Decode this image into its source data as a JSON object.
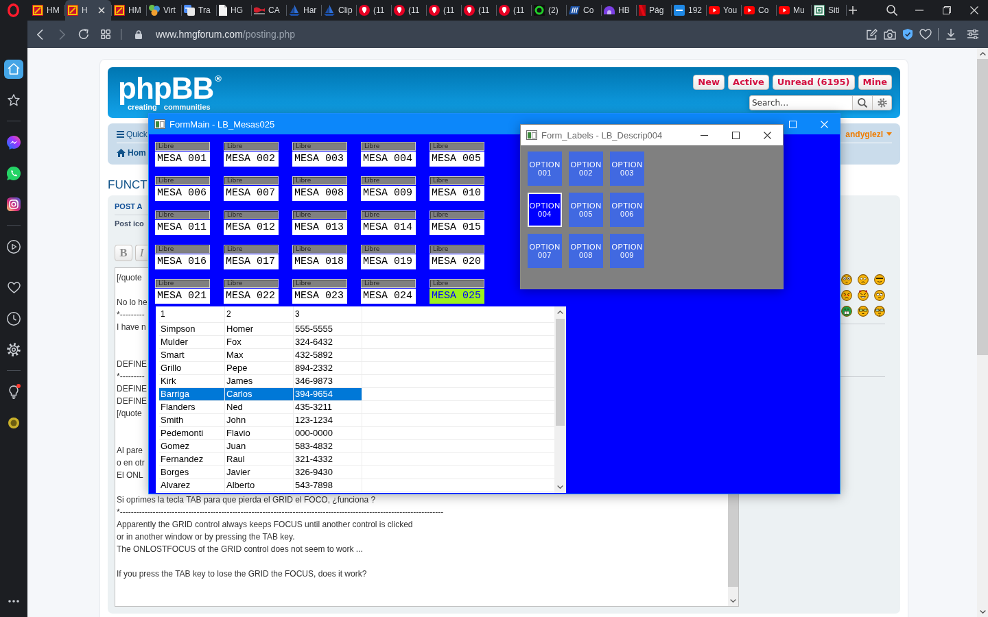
{
  "browser": {
    "tabs": [
      {
        "title": "HM",
        "kind": "hmg",
        "selected": false
      },
      {
        "title": "H",
        "kind": "hmg",
        "selected": true
      },
      {
        "title": "HM",
        "kind": "hmg",
        "selected": false
      },
      {
        "title": "Virt",
        "kind": "gears",
        "selected": false
      },
      {
        "title": "Tra",
        "kind": "translate",
        "selected": false
      },
      {
        "title": "HG",
        "kind": "document",
        "selected": false
      },
      {
        "title": "CA",
        "kind": "flag",
        "selected": false
      },
      {
        "title": "Har",
        "kind": "sail",
        "selected": false
      },
      {
        "title": "Clip",
        "kind": "sail",
        "selected": false
      },
      {
        "title": "(11",
        "kind": "pin",
        "selected": false
      },
      {
        "title": "(11",
        "kind": "pin",
        "selected": false
      },
      {
        "title": "(11",
        "kind": "pin",
        "selected": false
      },
      {
        "title": "(11",
        "kind": "pin",
        "selected": false
      },
      {
        "title": "(11",
        "kind": "pin",
        "selected": false
      },
      {
        "title": "(2)",
        "kind": "arc",
        "selected": false
      },
      {
        "title": "Co",
        "kind": "stripes",
        "selected": false
      },
      {
        "title": "HB",
        "kind": "arches",
        "selected": false
      },
      {
        "title": "Pág",
        "kind": "ribbon",
        "selected": false
      },
      {
        "title": "192",
        "kind": "tile",
        "selected": false
      },
      {
        "title": "You",
        "kind": "play",
        "selected": false
      },
      {
        "title": "Co",
        "kind": "play",
        "selected": false
      },
      {
        "title": "Mu",
        "kind": "play",
        "selected": false
      },
      {
        "title": "Siti",
        "kind": "seal",
        "selected": false
      }
    ],
    "address": {
      "url": "**www.hmgforum.com**/posting.php"
    },
    "sidebar": {
      "groups": [
        [
          {
            "kind": "home",
            "selected": true,
            "badge": false
          },
          {
            "kind": "star",
            "selected": false,
            "badge": false
          }
        ],
        [
          {
            "kind": "chat",
            "selected": false,
            "badge": false
          },
          {
            "kind": "phone",
            "selected": false,
            "badge": false
          },
          {
            "kind": "camera",
            "selected": false,
            "badge": false
          }
        ],
        [
          {
            "kind": "player",
            "selected": false,
            "badge": false
          },
          {
            "kind": "heart",
            "selected": false,
            "badge": false
          },
          {
            "kind": "history",
            "selected": false,
            "badge": false
          },
          {
            "kind": "settings",
            "selected": false,
            "badge": false
          }
        ],
        [
          {
            "kind": "bulb",
            "selected": false,
            "badge": true
          },
          {
            "kind": "extension",
            "selected": false,
            "badge": false
          }
        ]
      ]
    }
  },
  "forum": {
    "logo": {
      "name": "phpBB$^{®}$",
      "tagline": [
        "creating",
        "communities"
      ]
    },
    "quick_links": [
      "New",
      "Active",
      "Unread (6195)",
      "Mine"
    ],
    "search": {
      "placeholder": "Search…"
    },
    "navbar": {
      "quick_links": "Quick",
      "home": "Hom",
      "user": "andyglezl"
    },
    "title": "FUNCT",
    "post": {
      "heading": "POST A",
      "post_icon_label": "Post ico",
      "format_buttons": [
        {
          "label": "B",
          "kind": "bold"
        },
        {
          "label": "I",
          "kind": "italic"
        }
      ],
      "message": [
        {
          "kind": "text",
          "text": "[/quote"
        },
        {
          "kind": "blank"
        },
        {
          "kind": "text",
          "text": "No lo he"
        },
        {
          "kind": "text",
          "text": "*---------"
        },
        {
          "kind": "text",
          "text": "I have n"
        },
        {
          "kind": "blank"
        },
        {
          "kind": "blank"
        },
        {
          "kind": "text",
          "text": "DEFINE"
        },
        {
          "kind": "text",
          "text": "*---------"
        },
        {
          "kind": "text",
          "text": "DEFINE"
        },
        {
          "kind": "text",
          "text": "DEFINE"
        },
        {
          "kind": "text",
          "text": "[/quote"
        },
        {
          "kind": "blank"
        },
        {
          "kind": "blank"
        },
        {
          "kind": "text",
          "text": "Al pare"
        },
        {
          "kind": "text",
          "text": "o en otr"
        },
        {
          "kind": "text",
          "text": "El ONL"
        },
        {
          "kind": "blank"
        },
        {
          "kind": "text",
          "text": "Si oprimes la tecla TAB para que pierda el GRID el FOCO, ¿funciona ?"
        },
        {
          "kind": "text",
          "text": "*----------------------------------------------------------------------------------------------------------------------"
        },
        {
          "kind": "text",
          "text": "Apparently the GRID control always keeps FOCUS until another control is clicked"
        },
        {
          "kind": "text",
          "text": "or in another window or by pressing the TAB key."
        },
        {
          "kind": "text",
          "text": "The ONLOSTFOCUS of the GRID control does not seem to work ..."
        },
        {
          "kind": "blank"
        },
        {
          "kind": "text",
          "text": "If you press the TAB key to lose the GRID the FOCUS, does it work?"
        }
      ]
    }
  },
  "form_main": {
    "title": "FormMain - LB_Mesas025",
    "tables": [
      {
        "status": "Libre",
        "name": "MESA 001",
        "selected": false
      },
      {
        "status": "Libre",
        "name": "MESA 002",
        "selected": false
      },
      {
        "status": "Libre",
        "name": "MESA 003",
        "selected": false
      },
      {
        "status": "Libre",
        "name": "MESA 004",
        "selected": false
      },
      {
        "status": "Libre",
        "name": "MESA 005",
        "selected": false
      },
      {
        "status": "Libre",
        "name": "MESA 006",
        "selected": false
      },
      {
        "status": "Libre",
        "name": "MESA 007",
        "selected": false
      },
      {
        "status": "Libre",
        "name": "MESA 008",
        "selected": false
      },
      {
        "status": "Libre",
        "name": "MESA 009",
        "selected": false
      },
      {
        "status": "Libre",
        "name": "MESA 010",
        "selected": false
      },
      {
        "status": "Libre",
        "name": "MESA 011",
        "selected": false
      },
      {
        "status": "Libre",
        "name": "MESA 012",
        "selected": false
      },
      {
        "status": "Libre",
        "name": "MESA 013",
        "selected": false
      },
      {
        "status": "Libre",
        "name": "MESA 014",
        "selected": false
      },
      {
        "status": "Libre",
        "name": "MESA 015",
        "selected": false
      },
      {
        "status": "Libre",
        "name": "MESA 016",
        "selected": false
      },
      {
        "status": "Libre",
        "name": "MESA 017",
        "selected": false
      },
      {
        "status": "Libre",
        "name": "MESA 018",
        "selected": false
      },
      {
        "status": "Libre",
        "name": "MESA 019",
        "selected": false
      },
      {
        "status": "Libre",
        "name": "MESA 020",
        "selected": false
      },
      {
        "status": "Libre",
        "name": "MESA 021",
        "selected": false
      },
      {
        "status": "Libre",
        "name": "MESA 022",
        "selected": false
      },
      {
        "status": "Libre",
        "name": "MESA 023",
        "selected": false
      },
      {
        "status": "Libre",
        "name": "MESA 024",
        "selected": false
      },
      {
        "status": "Libre",
        "name": "MESA 025",
        "selected": true
      }
    ],
    "grid": {
      "columns": [
        "1",
        "2",
        "3"
      ],
      "rows": [
        {
          "cells": [
            "Simpson",
            "Homer",
            "555-5555"
          ],
          "selected": false
        },
        {
          "cells": [
            "Mulder",
            "Fox",
            "324-6432"
          ],
          "selected": false
        },
        {
          "cells": [
            "Smart",
            "Max",
            "432-5892"
          ],
          "selected": false
        },
        {
          "cells": [
            "Grillo",
            "Pepe",
            "894-2332"
          ],
          "selected": false
        },
        {
          "cells": [
            "Kirk",
            "James",
            "346-9873"
          ],
          "selected": false
        },
        {
          "cells": [
            "Barriga",
            "Carlos",
            "394-9654"
          ],
          "selected": true
        },
        {
          "cells": [
            "Flanders",
            "Ned",
            "435-3211"
          ],
          "selected": false
        },
        {
          "cells": [
            "Smith",
            "John",
            "123-1234"
          ],
          "selected": false
        },
        {
          "cells": [
            "Pedemonti",
            "Flavio",
            "000-0000"
          ],
          "selected": false
        },
        {
          "cells": [
            "Gomez",
            "Juan",
            "583-4832"
          ],
          "selected": false
        },
        {
          "cells": [
            "Fernandez",
            "Raul",
            "321-4332"
          ],
          "selected": false
        },
        {
          "cells": [
            "Borges",
            "Javier",
            "326-9430"
          ],
          "selected": false
        },
        {
          "cells": [
            "Alvarez",
            "Alberto",
            "543-7898"
          ],
          "selected": false
        }
      ]
    }
  },
  "form_labels": {
    "title": "Form_Labels - LB_Descrip004",
    "options": [
      {
        "label": "OPTION 001",
        "selected": false
      },
      {
        "label": "OPTION 002",
        "selected": false
      },
      {
        "label": "OPTION 003",
        "selected": false
      },
      {
        "label": "OPTION 004",
        "selected": true
      },
      {
        "label": "OPTION 005",
        "selected": false
      },
      {
        "label": "OPTION 006",
        "selected": false
      },
      {
        "label": "OPTION 007",
        "selected": false
      },
      {
        "label": "OPTION 008",
        "selected": false
      },
      {
        "label": "OPTION 009",
        "selected": false
      }
    ]
  }
}
